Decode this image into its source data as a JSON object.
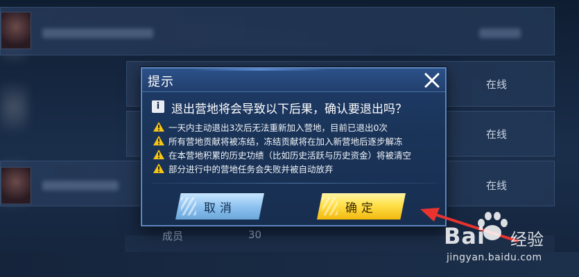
{
  "background": {
    "rows": [
      {
        "status": "在线"
      },
      {
        "status": "在线"
      },
      {
        "status": "在线"
      }
    ],
    "footer": {
      "label": "成员",
      "value": "30"
    }
  },
  "dialog": {
    "title": "提示",
    "close_icon": "close-icon",
    "info_icon_text": "i",
    "question": "退出营地将会导致以下后果，确认要退出吗？",
    "warnings": [
      "一天内主动退出3次后无法重新加入营地，目前已退出0次",
      "所有营地贡献将被冻结，冻结贡献将在加入新营地后逐步解冻",
      "在本营地积累的历史功绩（比如历史活跃与历史资金）将被清空",
      "部分进行中的营地任务会失败并被自动放弃"
    ],
    "buttons": {
      "cancel": "取消",
      "confirm": "确定"
    }
  },
  "watermark": {
    "brand": "Bai",
    "brand_suffix": "经验",
    "url": "jingyan.baidu.com"
  },
  "colors": {
    "dialog_bg": "#1a3459",
    "dialog_border": "#5f86bf",
    "cancel_button": "#8fc3f0",
    "confirm_button": "#ffe04a",
    "warning_icon": "#f5c518",
    "annotation_arrow": "#e8332f"
  }
}
